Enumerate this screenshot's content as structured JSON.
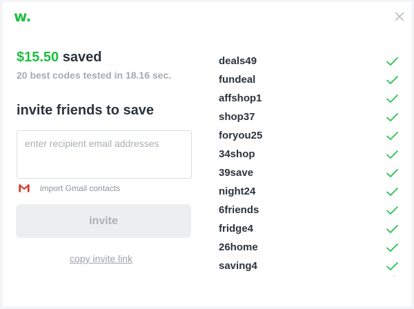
{
  "brand": {
    "logo_text": "w.",
    "accent_color": "#1dc03f"
  },
  "header": {
    "close_icon": "close-icon"
  },
  "summary": {
    "amount": "$15.50",
    "saved_word": " saved",
    "tested_text": "20 best codes tested in 18.16 sec."
  },
  "invite": {
    "heading": "invite friends to save",
    "email_placeholder": "enter recipient email addresses",
    "email_value": "",
    "gmail_icon": "gmail-icon",
    "gmail_label": "import Gmail contacts",
    "button_label": "invite",
    "copy_link_label": "copy invite link"
  },
  "codes": [
    {
      "code": "deals49",
      "status": "check-icon"
    },
    {
      "code": "fundeal",
      "status": "check-icon"
    },
    {
      "code": "affshop1",
      "status": "check-icon"
    },
    {
      "code": "shop37",
      "status": "check-icon"
    },
    {
      "code": "foryou25",
      "status": "check-icon"
    },
    {
      "code": "34shop",
      "status": "check-icon"
    },
    {
      "code": "39save",
      "status": "check-icon"
    },
    {
      "code": "night24",
      "status": "check-icon"
    },
    {
      "code": "6friends",
      "status": "check-icon"
    },
    {
      "code": "fridge4",
      "status": "check-icon"
    },
    {
      "code": "26home",
      "status": "check-icon"
    },
    {
      "code": "saving4",
      "status": "check-icon"
    }
  ],
  "colors": {
    "saved_green": "#1dbf40",
    "check_green": "#27c24c",
    "text_dark": "#2b333c",
    "text_muted": "#a5abb1",
    "gmail_red": "#d93025"
  }
}
